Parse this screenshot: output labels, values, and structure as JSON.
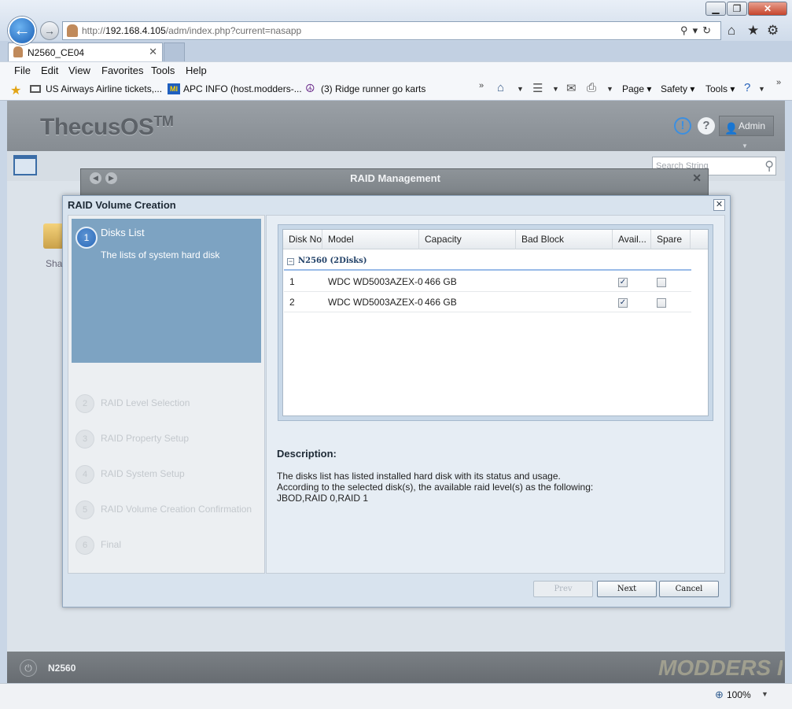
{
  "browser": {
    "url_prefix": "http://",
    "url_host": "192.168.4.105",
    "url_path": "/adm/index.php?current=nasapp",
    "tab_title": "N2560_CE04",
    "tab_close": "✕",
    "window_buttons": {
      "minimize": "▁",
      "maximize": "❐",
      "close": "✕"
    },
    "menu": [
      "File",
      "Edit",
      "View",
      "Favorites",
      "Tools",
      "Help"
    ],
    "favorites": [
      "US Airways",
      "Airline tickets,...",
      "APC INFO (host.modders-...",
      "(3) Ridge runner go karts"
    ],
    "commands": [
      "Page ▾",
      "Safety ▾",
      "Tools ▾"
    ],
    "zoom": "100%"
  },
  "os": {
    "logo": "ThecusOS",
    "logo_mark": "TM",
    "user": "Admin",
    "search_placeholder": "Search String",
    "share_label": "Sha",
    "model": "N2560"
  },
  "raid_management": {
    "title": "RAID Management"
  },
  "dialog": {
    "title": "RAID Volume Creation",
    "close": "✕",
    "steps": [
      {
        "num": "1",
        "label": "Disks List",
        "desc": "The lists of system hard disk"
      },
      {
        "num": "2",
        "label": "RAID Level Selection"
      },
      {
        "num": "3",
        "label": "RAID Property Setup"
      },
      {
        "num": "4",
        "label": "RAID System Setup"
      },
      {
        "num": "5",
        "label": "RAID Volume Creation Confirmation"
      },
      {
        "num": "6",
        "label": "Final"
      }
    ],
    "table": {
      "columns": [
        "Disk No",
        "Model",
        "Capacity",
        "Bad Block",
        "Avail...",
        "Spare"
      ],
      "group": "N2560 (2Disks)",
      "rows": [
        {
          "disk_no": "1",
          "model": "WDC WD5003AZEX-0",
          "capacity": "466 GB",
          "bad_block": "",
          "available": true,
          "spare": false
        },
        {
          "disk_no": "2",
          "model": "WDC WD5003AZEX-0",
          "capacity": "466 GB",
          "bad_block": "",
          "available": true,
          "spare": false
        }
      ]
    },
    "description": {
      "title": "Description:",
      "lines": [
        "The disks list has listed installed hard disk with its status and usage.",
        "According to the selected disk(s), the available raid level(s) as the following:",
        "JBOD,RAID 0,RAID 1"
      ]
    },
    "buttons": {
      "prev": "Prev",
      "next": "Next",
      "cancel": "Cancel"
    }
  },
  "watermark": "MODDERS INC"
}
